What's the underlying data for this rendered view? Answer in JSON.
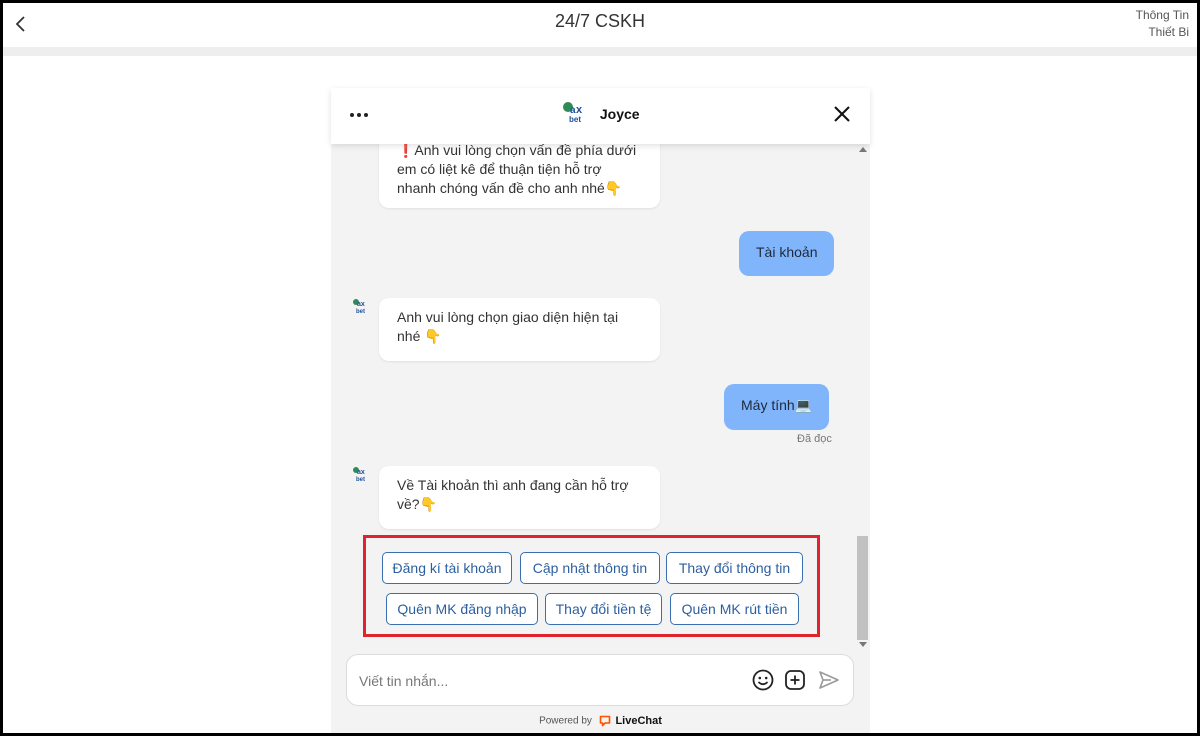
{
  "app_bar": {
    "title": "24/7 CSKH",
    "right_line1": "Thông Tin",
    "right_line2": "Thiết Bi"
  },
  "chat": {
    "agent_name": "Joyce",
    "messages": [
      {
        "from": "agent",
        "text": "❗Anh vui lòng chọn vấn đề phía dưới em có liệt kê để thuận tiện hỗ trợ nhanh chóng vấn đề cho anh nhé👇"
      },
      {
        "from": "user",
        "text": "Tài khoản"
      },
      {
        "from": "agent",
        "text": "Anh vui lòng chọn giao diện hiện tại nhé 👇"
      },
      {
        "from": "user",
        "text": "Máy tính💻"
      },
      {
        "from": "agent",
        "text": "Về Tài khoản thì anh đang cần hỗ trợ về?👇"
      }
    ],
    "read_status": "Đã đọc",
    "quick_replies": [
      "Đăng kí tài khoản",
      "Cập nhật thông tin",
      "Thay đổi thông tin",
      "Quên MK đăng nhập",
      "Thay đổi tiền tệ",
      "Quên MK rút tiền"
    ],
    "composer": {
      "placeholder": "Viết tin nhắn..."
    },
    "powered_by": {
      "label": "Powered by",
      "brand": "LiveChat"
    }
  },
  "icons": {
    "back": "chevron-left-icon",
    "menu": "more-horizontal-icon",
    "close": "close-icon",
    "emoji": "smiley-icon",
    "attach": "plus-square-icon",
    "send": "send-icon"
  },
  "colors": {
    "user_bubble": "#81b5fb",
    "quick_reply_border": "#3a6fb0",
    "highlight_box": "#e0242e",
    "livechat_brand": "#ff5100"
  }
}
